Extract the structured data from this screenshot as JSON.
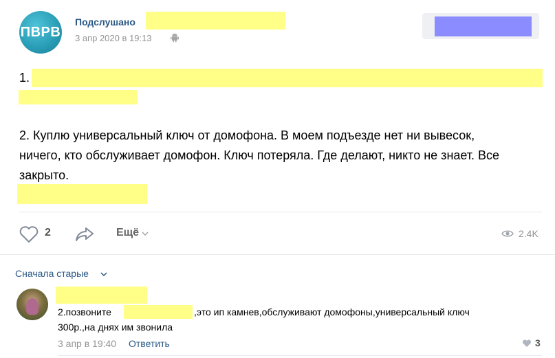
{
  "post": {
    "group_name": "Подслушано",
    "date": "3 апр 2020 в 19:13",
    "icon": "android-icon",
    "item1_number": "1.",
    "item2_line1": "2. Куплю универсальный ключ от домофона. В моем подъезде нет ни вывесок,",
    "item2_line2": "ничего, кто обслуживает домофон. Ключ потеряла. Где делают, никто не знает. Все",
    "item2_line3": "закрыто.",
    "avatar_text": "ПВРВ"
  },
  "actions": {
    "likes": "2",
    "more_label": "Ещё",
    "views": "2.4K",
    "like_icon": "heart-icon",
    "share_icon": "share-icon",
    "views_icon": "eye-icon"
  },
  "comments": {
    "sort_label": "Сначала старые",
    "items": [
      {
        "text_prefix": "2.позвоните",
        "text_suffix": ",это ип камнев,обслуживают домофоны,универсальный ключ",
        "text_line2": "300р.,на днях им звонила",
        "date": "3 апр в 19:40",
        "reply_label": "Ответить",
        "likes": "3"
      }
    ]
  },
  "colors": {
    "link": "#2a5885",
    "redaction_yellow": "#ffff88",
    "redaction_blue": "#8a8cff"
  }
}
